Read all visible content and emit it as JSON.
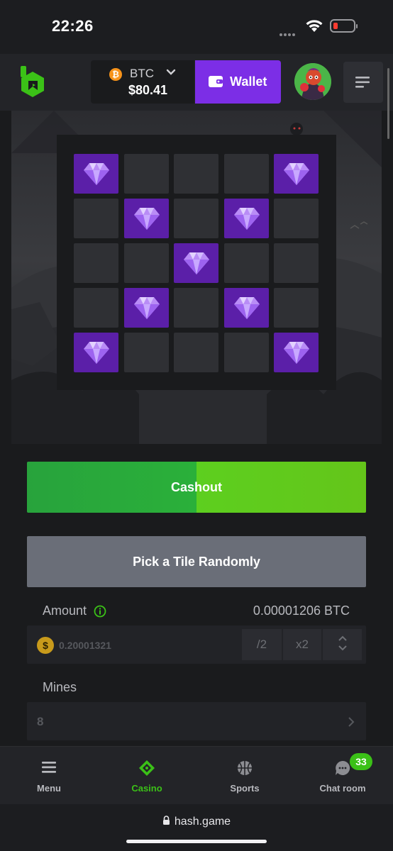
{
  "status_bar": {
    "time": "22:26"
  },
  "header": {
    "currency": "BTC",
    "balance": "$80.41",
    "wallet_label": "Wallet"
  },
  "game": {
    "grid": [
      [
        true,
        false,
        false,
        false,
        true
      ],
      [
        false,
        true,
        false,
        true,
        false
      ],
      [
        false,
        false,
        true,
        false,
        false
      ],
      [
        false,
        true,
        false,
        true,
        false
      ],
      [
        true,
        false,
        false,
        false,
        true
      ]
    ]
  },
  "controls": {
    "cashout_label": "Cashout",
    "random_label": "Pick a Tile Randomly",
    "amount_label": "Amount",
    "amount_btc": "0.00001206 BTC",
    "bet_value": "0.20001321",
    "half_label": "/2",
    "double_label": "x2",
    "mines_label": "Mines",
    "mines_value": "8"
  },
  "bottom_nav": {
    "items": [
      {
        "label": "Menu",
        "icon": "hamburger-icon",
        "active": false
      },
      {
        "label": "Casino",
        "icon": "casino-icon",
        "active": true
      },
      {
        "label": "Sports",
        "icon": "basketball-icon",
        "active": false
      },
      {
        "label": "Chat room",
        "icon": "chat-icon",
        "active": false
      }
    ],
    "chat_badge": "33"
  },
  "browser": {
    "url": "hash.game"
  },
  "colors": {
    "accent_green": "#3bc117",
    "wallet_purple": "#7c2ee6",
    "gem_tile": "#5b1fa8"
  }
}
